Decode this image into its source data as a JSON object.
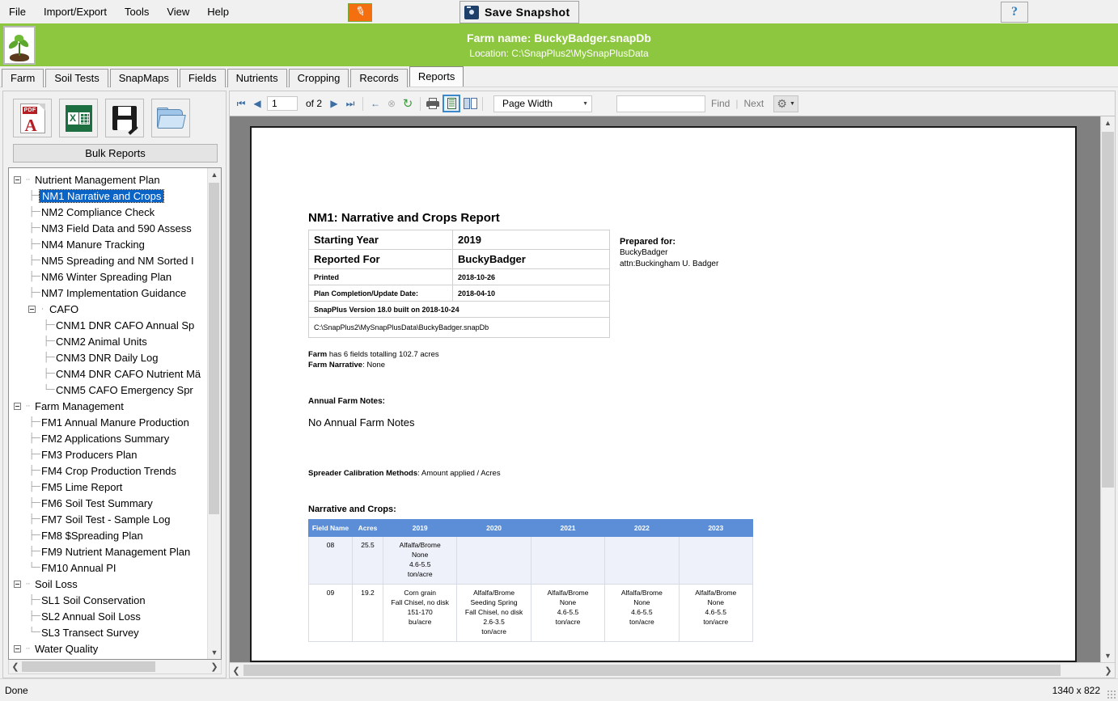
{
  "menubar": {
    "items": [
      {
        "label": "File"
      },
      {
        "label": "Import/Export"
      },
      {
        "label": "Tools"
      },
      {
        "label": "View"
      },
      {
        "label": "Help"
      }
    ],
    "ruler_button": {
      "name": "ruler-icon",
      "glyph": "✎"
    },
    "snapshot_button": {
      "label": "Save  Snapshot",
      "icon": "camera-icon"
    },
    "help_button": {
      "label": "?"
    }
  },
  "banner": {
    "farm_name": "Farm name: BuckyBadger.snapDb",
    "location": "Location: C:\\SnapPlus2\\MySnapPlusData",
    "color": "#8dc63f",
    "logo": "seedling-logo"
  },
  "tabs": [
    {
      "label": "Farm",
      "active": false
    },
    {
      "label": "Soil Tests",
      "active": false
    },
    {
      "label": "SnapMaps",
      "active": false
    },
    {
      "label": "Fields",
      "active": false
    },
    {
      "label": "Nutrients",
      "active": false
    },
    {
      "label": "Cropping",
      "active": false
    },
    {
      "label": "Records",
      "active": false
    },
    {
      "label": "Reports",
      "active": true
    }
  ],
  "sidebar": {
    "export_buttons": [
      {
        "name": "export-pdf-button",
        "icon": "pdf-icon",
        "badge": "PDF",
        "letter": "A"
      },
      {
        "name": "export-excel-button",
        "icon": "excel-icon",
        "letter": "X"
      },
      {
        "name": "save-report-button",
        "icon": "floppy-save-icon"
      },
      {
        "name": "open-folder-button",
        "icon": "folder-open-icon"
      }
    ],
    "bulk_reports_label": "Bulk Reports",
    "tree": [
      {
        "label": "Nutrient Management Plan",
        "level": 0,
        "node": true,
        "selected": false
      },
      {
        "label": "NM1 Narrative and Crops",
        "level": 1,
        "node": false,
        "selected": true
      },
      {
        "label": "NM2 Compliance Check",
        "level": 1,
        "node": false,
        "selected": false
      },
      {
        "label": "NM3 Field Data and 590 Assess",
        "level": 1,
        "node": false,
        "selected": false
      },
      {
        "label": "NM4 Manure Tracking",
        "level": 1,
        "node": false,
        "selected": false
      },
      {
        "label": "NM5 Spreading and NM Sorted I",
        "level": 1,
        "node": false,
        "selected": false
      },
      {
        "label": "NM6 Winter Spreading Plan",
        "level": 1,
        "node": false,
        "selected": false
      },
      {
        "label": "NM7 Implementation Guidance",
        "level": 1,
        "node": false,
        "selected": false
      },
      {
        "label": "CAFO",
        "level": 1,
        "node": true,
        "selected": false
      },
      {
        "label": "CNM1 DNR CAFO Annual Sp",
        "level": 2,
        "node": false,
        "selected": false
      },
      {
        "label": "CNM2 Animal Units",
        "level": 2,
        "node": false,
        "selected": false
      },
      {
        "label": "CNM3 DNR Daily Log",
        "level": 2,
        "node": false,
        "selected": false
      },
      {
        "label": "CNM4 DNR CAFO Nutrient Mä",
        "level": 2,
        "node": false,
        "selected": false
      },
      {
        "label": "CNM5 CAFO Emergency Spr",
        "level": 2,
        "node": false,
        "selected": false
      },
      {
        "label": "Farm Management",
        "level": 0,
        "node": true,
        "selected": false
      },
      {
        "label": "FM1 Annual Manure Production",
        "level": 1,
        "node": false,
        "selected": false
      },
      {
        "label": "FM2 Applications Summary",
        "level": 1,
        "node": false,
        "selected": false
      },
      {
        "label": "FM3 Producers Plan",
        "level": 1,
        "node": false,
        "selected": false
      },
      {
        "label": "FM4 Crop Production Trends",
        "level": 1,
        "node": false,
        "selected": false
      },
      {
        "label": "FM5 Lime Report",
        "level": 1,
        "node": false,
        "selected": false
      },
      {
        "label": "FM6 Soil Test Summary",
        "level": 1,
        "node": false,
        "selected": false
      },
      {
        "label": "FM7 Soil Test - Sample Log",
        "level": 1,
        "node": false,
        "selected": false
      },
      {
        "label": "FM8 $Spreading Plan",
        "level": 1,
        "node": false,
        "selected": false
      },
      {
        "label": "FM9 Nutrient Management Plan",
        "level": 1,
        "node": false,
        "selected": false
      },
      {
        "label": "FM10 Annual PI",
        "level": 1,
        "node": false,
        "selected": false
      },
      {
        "label": "Soil Loss",
        "level": 0,
        "node": true,
        "selected": false
      },
      {
        "label": "SL1 Soil Conservation",
        "level": 1,
        "node": false,
        "selected": false
      },
      {
        "label": "SL2 Annual Soil Loss",
        "level": 1,
        "node": false,
        "selected": false
      },
      {
        "label": "SL3 Transect Survey",
        "level": 1,
        "node": false,
        "selected": false
      },
      {
        "label": "Water Quality",
        "level": 0,
        "node": true,
        "selected": false
      }
    ]
  },
  "viewer_toolbar": {
    "first_page": "⏮",
    "prev_page": "◀",
    "page_number": "1",
    "of_label": "of 2",
    "next_page": "▶",
    "last_page": "⏭",
    "back": "←",
    "stop": "⊗",
    "refresh": "↻",
    "print": "print-icon",
    "one_page": "one-page-icon",
    "two_page": "two-page-icon",
    "zoom_value": "Page Width",
    "find_value": "",
    "find_label": "Find",
    "next_label": "Next",
    "gear": "gear-icon"
  },
  "report": {
    "title": "NM1: Narrative and Crops Report",
    "info_rows": [
      {
        "key": "Starting Year",
        "value": "2019",
        "size": "big"
      },
      {
        "key": "Reported For",
        "value": "BuckyBadger",
        "size": "big"
      },
      {
        "key": "Printed",
        "value": "2018-10-26",
        "size": "small"
      },
      {
        "key": "Plan Completion/Update Date:",
        "value": "2018-04-10",
        "size": "small"
      }
    ],
    "version_row": "SnapPlus Version   18.0 built on 2018-10-24",
    "path_row": "C:\\SnapPlus2\\MySnapPlusData\\BuckyBadger.snapDb",
    "prepared_for": {
      "heading": "Prepared for:",
      "line1": "BuckyBadger",
      "line2": "attn:Buckingham  U.  Badger"
    },
    "farm_summary_label": "Farm",
    "farm_summary_text": " has 6 fields totalling 102.7 acres",
    "farm_narrative_label": "Farm Narrative",
    "farm_narrative_text": ": None",
    "annual_notes_heading": "Annual Farm Notes:",
    "annual_notes_body": "No Annual Farm Notes",
    "spreader_label": "Spreader Calibration Methods",
    "spreader_value": ": Amount applied / Acres",
    "crops_heading": "Narrative and Crops:",
    "crops_table": {
      "columns": [
        "Field Name",
        "Acres",
        "2019",
        "2020",
        "2021",
        "2022",
        "2023"
      ],
      "header_color": "#5b8ed6",
      "rows": [
        {
          "field": "08",
          "acres": "25.5",
          "cells": [
            [
              "Alfalfa/Brome",
              "None",
              "4.6-5.5",
              "ton/acre"
            ],
            [],
            [],
            [],
            []
          ]
        },
        {
          "field": "09",
          "acres": "19.2",
          "cells": [
            [
              "Corn grain",
              "Fall Chisel, no disk",
              "151-170",
              "bu/acre"
            ],
            [
              "Alfalfa/Brome",
              "Seeding Spring",
              "Fall Chisel, no disk",
              "2.6-3.5",
              "ton/acre"
            ],
            [
              "Alfalfa/Brome",
              "None",
              "4.6-5.5",
              "ton/acre"
            ],
            [
              "Alfalfa/Brome",
              "None",
              "4.6-5.5",
              "ton/acre"
            ],
            [
              "Alfalfa/Brome",
              "None",
              "4.6-5.5",
              "ton/acre"
            ]
          ]
        }
      ]
    }
  },
  "statusbar": {
    "left": "Done",
    "right": "1340 x 822"
  }
}
